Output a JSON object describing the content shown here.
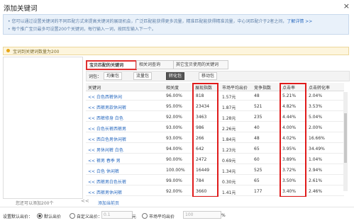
{
  "dialog": {
    "title": "添加关键词",
    "close": "×"
  },
  "info": {
    "line1": "您可以通过设置关键词的不同匹配方式来提高关键词的展现机会，广泛匹配能获得更多流量，精准匹配能获得精准流量，中心词匹配介于2者之间，",
    "link": "了解详情 >>",
    "line2": "每个推广宝贝最多可设置200个关键词，每行输入一词，按回车输入下一个。"
  },
  "warning": "宝词到关键词数量为200",
  "left": {
    "hint": "您还可以添加200个",
    "arrow": "<<",
    "add_all": "添加当前页"
  },
  "tabs": [
    {
      "label": "宝贝匹配的关键词"
    },
    {
      "label": "相关词查询"
    },
    {
      "label": "其它宝贝使用的关键词"
    }
  ],
  "filters": {
    "label": "词包：",
    "chips": [
      "均衡包",
      "流量包",
      "转化包",
      "移动包"
    ]
  },
  "table": {
    "headers": [
      "关键词",
      "相关度",
      "展现指数",
      "市场平均出价",
      "竞争指数",
      "点击率",
      "点击转化率"
    ],
    "rows": [
      {
        "kw": "<< 白色西裤休闲",
        "rel": "96.00%",
        "imp": "818",
        "cpc": "1.57元",
        "comp": "48",
        "ctr": "5.21%",
        "cvr": "2.04%"
      },
      {
        "kw": "<< 西裤男款休闲裤",
        "rel": "95.00%",
        "imp": "23434",
        "cpc": "1.87元",
        "comp": "521",
        "ctr": "4.82%",
        "cvr": "3.53%"
      },
      {
        "kw": "<< 西裤修身 白色",
        "rel": "92.00%",
        "imp": "3463",
        "cpc": "1.28元",
        "comp": "235",
        "ctr": "4.44%",
        "cvr": "5.04%"
      },
      {
        "kw": "<< 白色长裤西裤男",
        "rel": "93.00%",
        "imp": "986",
        "cpc": "2.26元",
        "comp": "40",
        "ctr": "4.00%",
        "cvr": "2.00%"
      },
      {
        "kw": "<< 西白色男休闲裤",
        "rel": "93.00%",
        "imp": "266",
        "cpc": "1.84元",
        "comp": "48",
        "ctr": "4.02%",
        "cvr": "16.66%"
      },
      {
        "kw": "<< 男休闲裤 白色",
        "rel": "94.00%",
        "imp": "642",
        "cpc": "1.23元",
        "comp": "65",
        "ctr": "3.95%",
        "cvr": "34.49%"
      },
      {
        "kw": "<< 裤男 春季 男",
        "rel": "90.00%",
        "imp": "2472",
        "cpc": "0.69元",
        "comp": "60",
        "ctr": "3.89%",
        "cvr": "1.04%"
      },
      {
        "kw": "<< 白色 休闲裤",
        "rel": "100.00%",
        "imp": "16449",
        "cpc": "1.34元",
        "comp": "525",
        "ctr": "3.72%",
        "cvr": "2.94%"
      },
      {
        "kw": "<< 西裤男白色长裤",
        "rel": "99.00%",
        "imp": "784",
        "cpc": "0.30元",
        "comp": "65",
        "ctr": "3.50%",
        "cvr": "2.61%"
      },
      {
        "kw": "<< 西裤男休闲裤",
        "rel": "92.00%",
        "imp": "3660",
        "cpc": "1.41元",
        "comp": "177",
        "ctr": "3.40%",
        "cvr": "2.46%"
      }
    ]
  },
  "bottom": {
    "label": "设置默认出价：",
    "opt1": "默认出价",
    "opt2": "自定义出价：",
    "price": "0.1",
    "unit": "元",
    "opt3": "市场平均出价",
    "percent": "100",
    "pct_sign": "%"
  }
}
